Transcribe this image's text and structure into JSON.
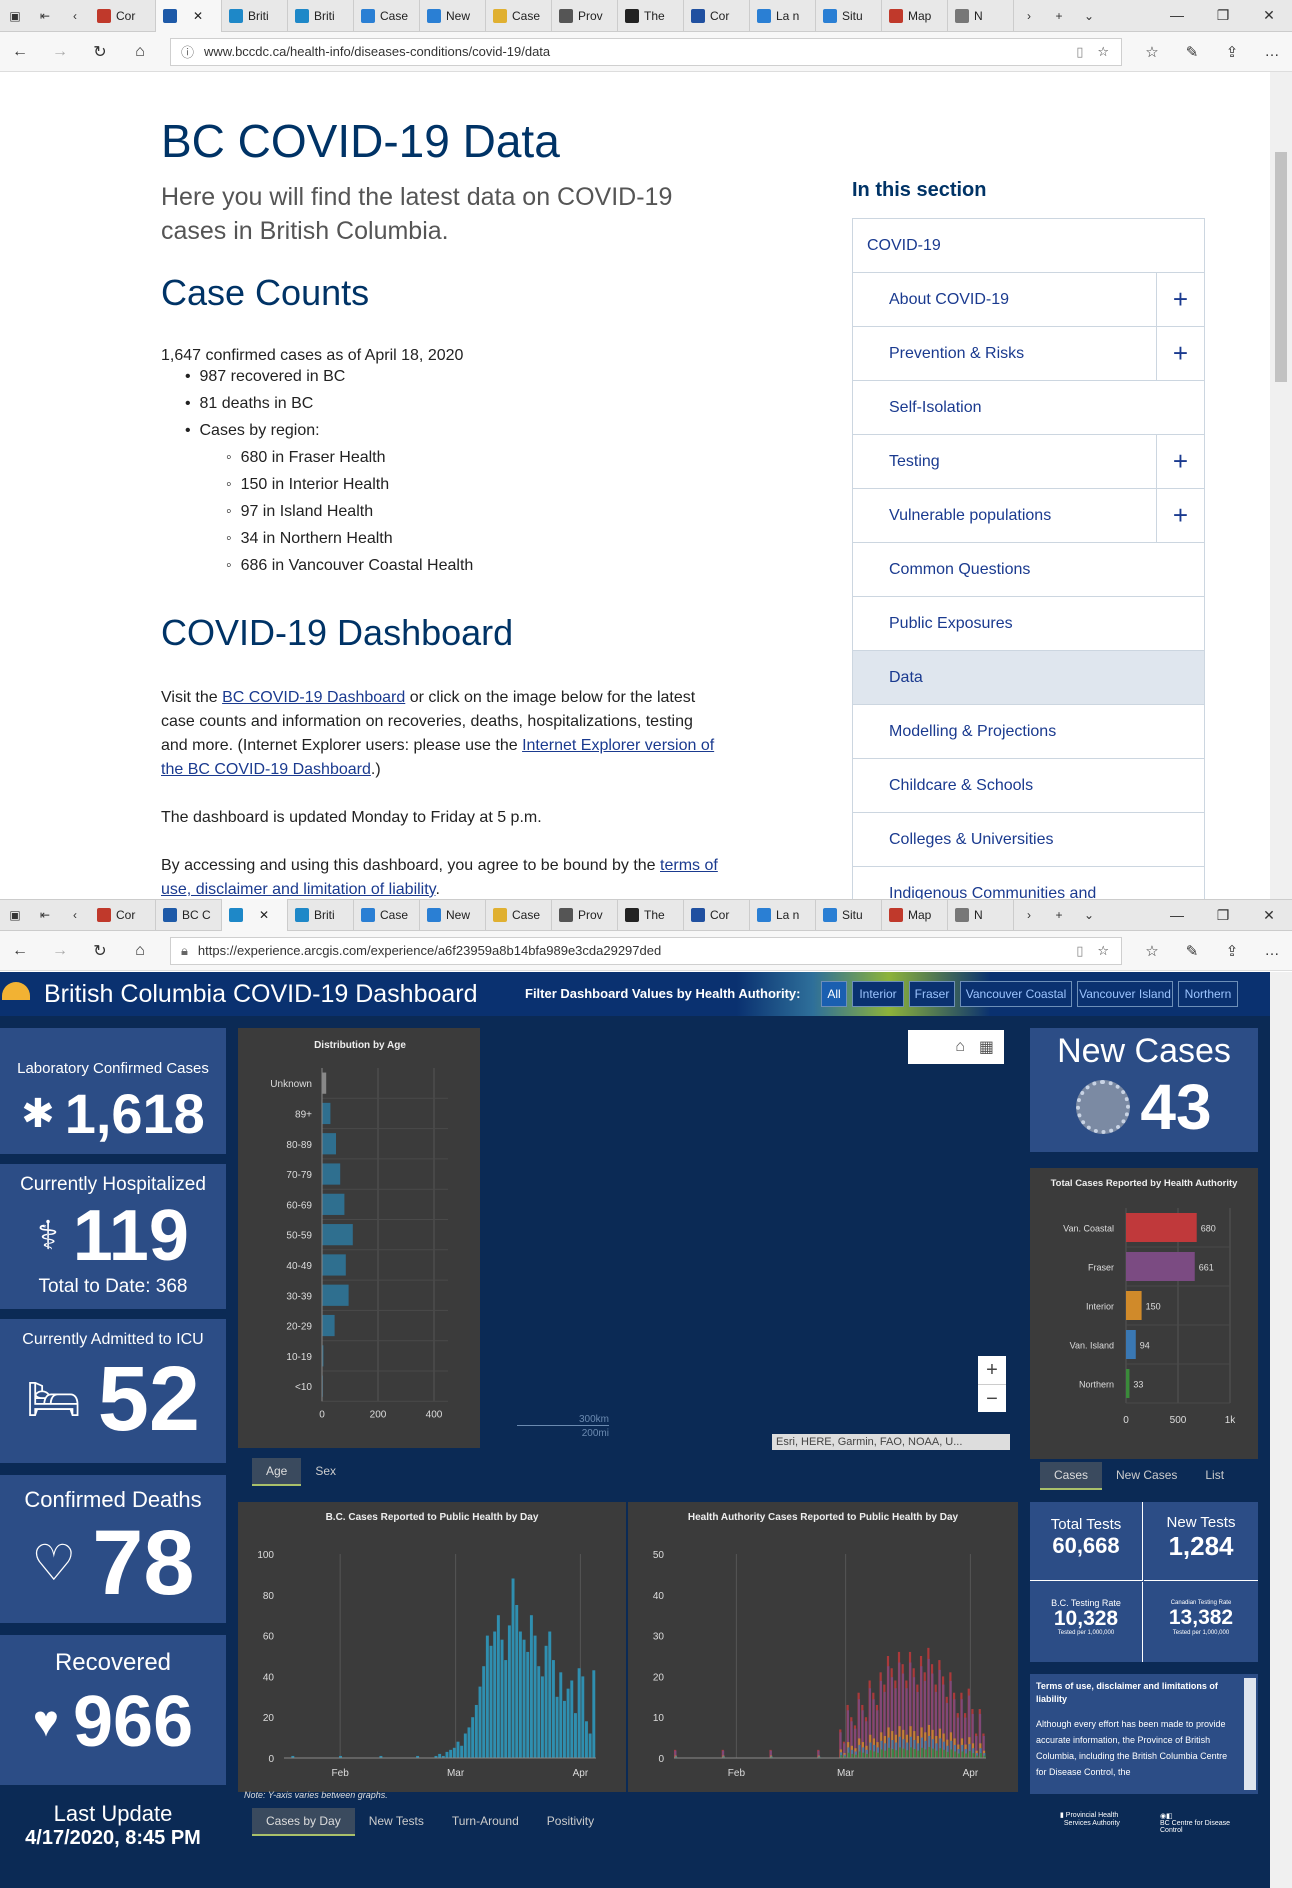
{
  "browser1": {
    "tabs": [
      "Cor",
      "",
      "Briti",
      "Briti",
      "Case",
      "New",
      "Case",
      "Prov",
      "The",
      "Cor",
      "La n",
      "Situ",
      "Map",
      "N"
    ],
    "url": "www.bccdc.ca/health-info/diseases-conditions/covid-19/data"
  },
  "article": {
    "title": "BC COVID-19 Data",
    "lead": "Here you will find the latest data on COVID-19 cases in British Columbia.",
    "case_counts_heading": "Case Counts",
    "confirmed": "1,647 confirmed cases as of April 18, 2020",
    "recovered": "987 recovered in BC",
    "deaths": "81 deaths in BC",
    "by_region": "Cases by region:",
    "regions": [
      "680 in Fraser Health",
      "150 in Interior Health",
      "97 in Island Health",
      "34 in Northern Health",
      "686 in Vancouver Coastal Health"
    ],
    "dashboard_heading": "COVID-19 Dashboard",
    "visit_prefix": "Visit the ",
    "dashboard_link": "BC COVID-19 Dashboard",
    "visit_mid": " or click on the image below for the latest case counts and information on recoveries, deaths, hospitalizations, testing and more. (Internet Explorer users: please use the ",
    "ie_link": "Internet Explorer version of the BC COVID-19 Dashboard",
    "visit_end": ".)",
    "updated": "The dashboard is updated Monday to Friday at 5 p.m.",
    "terms_prefix": "By accessing and using this dashboard, you agree to be bound by the ",
    "terms_link": "terms of use, disclaimer and limitation of liability",
    "terms_end": "."
  },
  "sidebar": {
    "heading": "In this section",
    "items": [
      {
        "label": "COVID-19",
        "plus": false,
        "selected": false
      },
      {
        "label": "About COVID-19",
        "plus": true,
        "selected": false
      },
      {
        "label": "Prevention & Risks",
        "plus": true,
        "selected": false
      },
      {
        "label": "Self-Isolation",
        "plus": false,
        "selected": false
      },
      {
        "label": "Testing",
        "plus": true,
        "selected": false
      },
      {
        "label": "Vulnerable populations",
        "plus": true,
        "selected": false
      },
      {
        "label": "Common Questions",
        "plus": false,
        "selected": false
      },
      {
        "label": "Public Exposures",
        "plus": false,
        "selected": false
      },
      {
        "label": "Data",
        "plus": false,
        "selected": true
      },
      {
        "label": "Modelling & Projections",
        "plus": false,
        "selected": false
      },
      {
        "label": "Childcare & Schools",
        "plus": false,
        "selected": false
      },
      {
        "label": "Colleges & Universities",
        "plus": false,
        "selected": false
      },
      {
        "label": "Indigenous Communities and",
        "plus": false,
        "selected": false
      }
    ]
  },
  "browser2": {
    "tabs": [
      "Cor",
      "BC C",
      "",
      "Briti",
      "Case",
      "New",
      "Case",
      "Prov",
      "The",
      "Cor",
      "La n",
      "Situ",
      "Map",
      "N"
    ],
    "url": "https://experience.arcgis.com/experience/a6f23959a8b14bfa989e3cda29297ded"
  },
  "dashboard": {
    "title": "British Columbia COVID-19 Dashboard",
    "filter_label": "Filter Dashboard Values by Health Authority:",
    "filters": [
      "All",
      "Interior",
      "Fraser",
      "Vancouver Coastal",
      "Vancouver Island",
      "Northern"
    ],
    "lab_confirmed_label": "Laboratory Confirmed Cases",
    "lab_confirmed": "1,618",
    "hosp_label": "Currently Hospitalized",
    "hosp": "119",
    "hosp_total": "Total to Date: 368",
    "icu_label": "Currently Admitted to ICU",
    "icu": "52",
    "deaths_label": "Confirmed Deaths",
    "deaths": "78",
    "recovered_label": "Recovered",
    "recovered": "966",
    "last_update_label": "Last Update",
    "last_update": "4/17/2020, 8:45 PM",
    "new_cases_label": "New Cases",
    "new_cases": "43",
    "total_tests_label": "Total Tests",
    "total_tests": "60,668",
    "new_tests_label": "New Tests",
    "new_tests": "1,284",
    "bc_rate_label": "B.C. Testing Rate",
    "bc_rate": "10,328",
    "bc_rate_unit": "Tested per 1,000,000",
    "ca_rate_label": "Canadian Testing Rate",
    "ca_rate": "13,382",
    "ca_rate_unit": "Tested per 1,000,000",
    "terms_title": "Terms of use, disclaimer and limitations of liability",
    "terms_text": "Although every effort has been made to provide accurate information, the Province of British Columbia, including the British Columbia Centre for Disease Control, the",
    "map_attr": "Esri, HERE, Garmin, FAO, NOAA, U...",
    "scale_km": "300km",
    "scale_mi": "200mi",
    "age_tabs": [
      "Age",
      "Sex"
    ],
    "ha_tabs": [
      "Cases",
      "New Cases",
      "List"
    ],
    "daily_tabs": [
      "Cases by Day",
      "New Tests",
      "Turn-Around",
      "Positivity"
    ],
    "note": "Note: Y-axis varies between graphs.",
    "zoom_in": "+",
    "zoom_out": "−"
  },
  "chart_data": [
    {
      "type": "bar",
      "title": "Distribution by Age",
      "orientation": "horizontal",
      "categories": [
        "Unknown",
        "89+",
        "80-89",
        "70-79",
        "60-69",
        "50-59",
        "40-49",
        "30-39",
        "20-29",
        "10-19",
        "<10"
      ],
      "values": [
        15,
        30,
        50,
        65,
        80,
        110,
        85,
        95,
        45,
        5,
        3
      ],
      "xlim": [
        0,
        450
      ],
      "xticks": [
        0,
        200,
        400
      ]
    },
    {
      "type": "bar",
      "title": "Total Cases Reported by Health Authority",
      "orientation": "horizontal",
      "categories": [
        "Van. Coastal",
        "Fraser",
        "Interior",
        "Van. Island",
        "Northern"
      ],
      "values": [
        680,
        661,
        150,
        94,
        33
      ],
      "colors": [
        "#c0393b",
        "#7b4b82",
        "#d08a2a",
        "#3a78b3",
        "#3a8a3a"
      ],
      "xlim": [
        0,
        1000
      ],
      "xticks": [
        "0",
        "500",
        "1k"
      ]
    },
    {
      "type": "bar",
      "title": "B.C. Cases Reported to Public Health by Day",
      "xticks": [
        "Feb",
        "Mar",
        "Apr"
      ],
      "ylim": [
        0,
        100
      ],
      "yticks": [
        0,
        20,
        40,
        60,
        80,
        100
      ],
      "values": [
        0,
        0,
        1,
        0,
        0,
        0,
        0,
        0,
        0,
        0,
        0,
        0,
        0,
        0,
        0,
        1,
        0,
        0,
        0,
        0,
        0,
        0,
        0,
        0,
        0,
        0,
        1,
        0,
        0,
        0,
        0,
        0,
        0,
        0,
        0,
        0,
        1,
        0,
        0,
        0,
        0,
        1,
        2,
        1,
        3,
        4,
        5,
        8,
        6,
        12,
        15,
        20,
        26,
        35,
        45,
        60,
        55,
        62,
        70,
        58,
        48,
        65,
        88,
        75,
        62,
        58,
        52,
        70,
        60,
        45,
        40,
        55,
        62,
        48,
        30,
        42,
        28,
        34,
        38,
        22,
        44,
        40,
        18,
        12,
        43
      ]
    },
    {
      "type": "bar",
      "title": "Health Authority Cases Reported to Public Health by Day",
      "xticks": [
        "Feb",
        "Mar",
        "Apr"
      ],
      "ylim": [
        0,
        50
      ],
      "yticks": [
        0,
        10,
        20,
        30,
        40,
        50
      ]
    }
  ]
}
